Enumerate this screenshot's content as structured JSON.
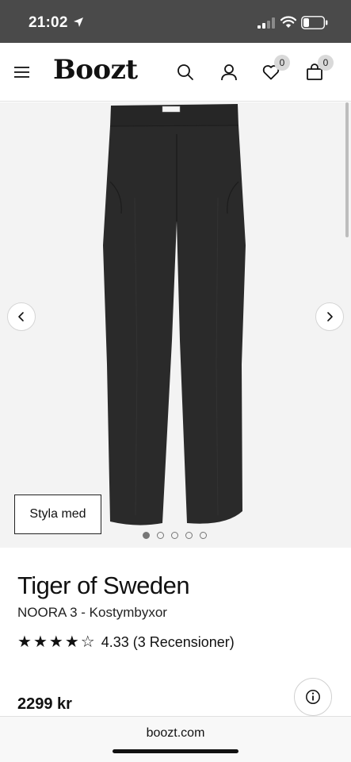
{
  "status_bar": {
    "time": "21:02",
    "icons": [
      "location-arrow-icon",
      "signal-icon",
      "wifi-icon",
      "battery-icon"
    ]
  },
  "header": {
    "logo": "Boozt",
    "icons": [
      "menu-icon",
      "search-icon",
      "user-icon",
      "heart-icon",
      "bag-icon"
    ],
    "wishlist_count": "0",
    "cart_count": "0"
  },
  "gallery": {
    "style_button": "Styla med",
    "dot_count": 5,
    "active_index": 0,
    "image": "black-trousers"
  },
  "product": {
    "brand": "Tiger of Sweden",
    "name": "NOORA 3 - Kostymbyxor",
    "rating": "4.33",
    "rating_stars": 4,
    "reviews": "(3 Recensioner)",
    "price": "2299 kr"
  },
  "browser": {
    "url": "boozt.com"
  },
  "colors": {
    "status_bar": "#4a4a4a",
    "gallery_bg": "#f3f3f3",
    "text": "#111111"
  }
}
